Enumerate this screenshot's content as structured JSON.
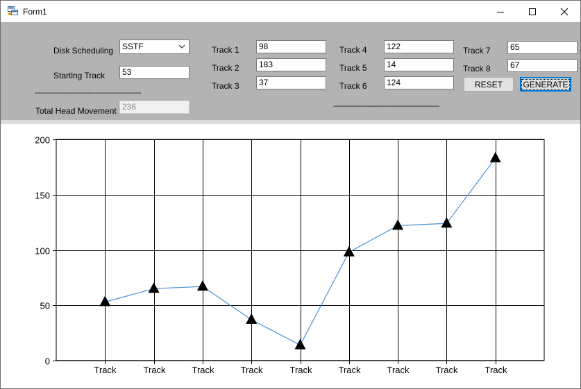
{
  "window": {
    "title": "Form1"
  },
  "form": {
    "disk_scheduling_label": "Disk Scheduling",
    "disk_scheduling_value": "SSTF",
    "starting_track_label": "Starting Track",
    "starting_track_value": "53",
    "separator_left": "--------------------------------------------------------",
    "separator_right": "--------------------------------------------------------",
    "total_head_movement_label": "Total Head Movement",
    "total_head_movement_value": "236",
    "tracks": [
      {
        "label": "Track 1",
        "value": "98"
      },
      {
        "label": "Track 2",
        "value": "183"
      },
      {
        "label": "Track 3",
        "value": "37"
      },
      {
        "label": "Track 4",
        "value": "122"
      },
      {
        "label": "Track 5",
        "value": "14"
      },
      {
        "label": "Track 6",
        "value": "124"
      },
      {
        "label": "Track 7",
        "value": "65"
      },
      {
        "label": "Track 8",
        "value": "67"
      }
    ],
    "reset_label": "RESET",
    "generate_label": "GENERATE"
  },
  "chart_data": {
    "type": "line",
    "categories": [
      "Track",
      "Track",
      "Track",
      "Track",
      "Track",
      "Track",
      "Track",
      "Track",
      "Track"
    ],
    "series": [
      {
        "values": [
          53,
          65,
          67,
          37,
          14,
          98,
          122,
          124,
          183
        ]
      }
    ],
    "ylim": [
      0,
      200
    ],
    "yticks": [
      0,
      50,
      100,
      150,
      200
    ],
    "grid": true,
    "marker": "triangle",
    "line_color": "#4a90d9",
    "marker_color": "#000000"
  }
}
